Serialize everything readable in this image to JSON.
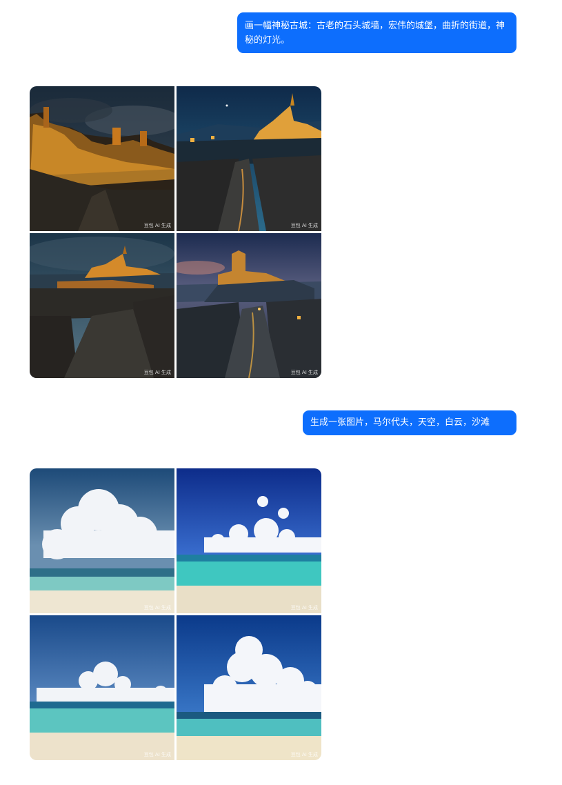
{
  "messages": [
    {
      "role": "user",
      "text": "画一幅神秘古城：古老的石头城墙，宏伟的城堡，曲折的街道，神秘的灯光。"
    },
    {
      "role": "user",
      "text": "生成一张图片，马尔代夫，天空，白云，沙滩"
    }
  ],
  "images": {
    "watermark": "豆包 AI 生成"
  },
  "colors": {
    "bubble": "#0d6efd",
    "bubble_text": "#ffffff",
    "background": "#ffffff"
  }
}
